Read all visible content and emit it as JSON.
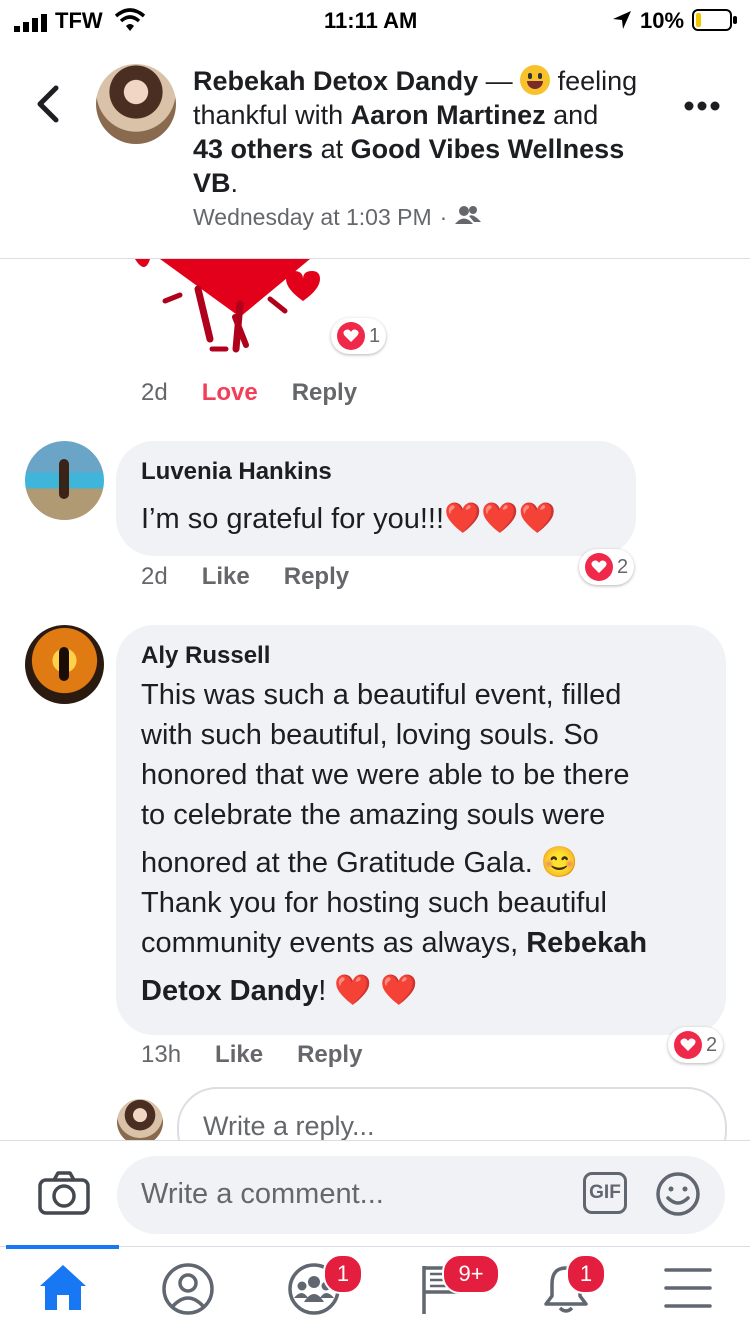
{
  "status_bar": {
    "carrier": "TFW",
    "time": "11:11 AM",
    "battery": "10%"
  },
  "header": {
    "author": "Rebekah Detox Dandy",
    "dash": " — ",
    "feeling": "feeling thankful with",
    "tagged": "Aaron Martinez",
    "and": "and",
    "others": "43 others",
    "at": "at",
    "place": "Good Vibes Wellness VB",
    "period": ".",
    "timestamp": "Wednesday at 1:03 PM",
    "separator": "·"
  },
  "comments": [
    {
      "time": "2d",
      "action": "Love",
      "reply": "Reply",
      "reaction_count": "1"
    },
    {
      "author": "Luvenia Hankins",
      "text": "I’m so grateful for you!!!",
      "hearts": "❤️❤️❤️",
      "time": "2d",
      "action": "Like",
      "reply": "Reply",
      "reaction_count": "2"
    },
    {
      "author": "Aly Russell",
      "lines": [
        "This was such a beautiful event, filled",
        "with such beautiful, loving souls. So",
        "honored that we were able to be there",
        "to celebrate the amazing souls were",
        "honored at the Gratitude Gala.",
        "Thank you for hosting such beautiful",
        "community events as always,"
      ],
      "mention_part1": "Rebekah",
      "mention_part2": "Detox Dandy",
      "exclaim": "!",
      "hearts": "❤️ ❤️",
      "smiley": "😊",
      "time": "13h",
      "action": "Like",
      "reply": "Reply",
      "reaction_count": "2"
    }
  ],
  "reply_box": {
    "placeholder": "Write a reply..."
  },
  "comment_bar": {
    "placeholder": "Write a comment...",
    "gif_label": "GIF"
  },
  "tab_bar": {
    "groups_badge": "1",
    "feed_badge": "9+",
    "notifications_badge": "1"
  },
  "colors": {
    "accent": "#1877f2",
    "love": "#f33e58",
    "badge": "#e41e3f"
  }
}
